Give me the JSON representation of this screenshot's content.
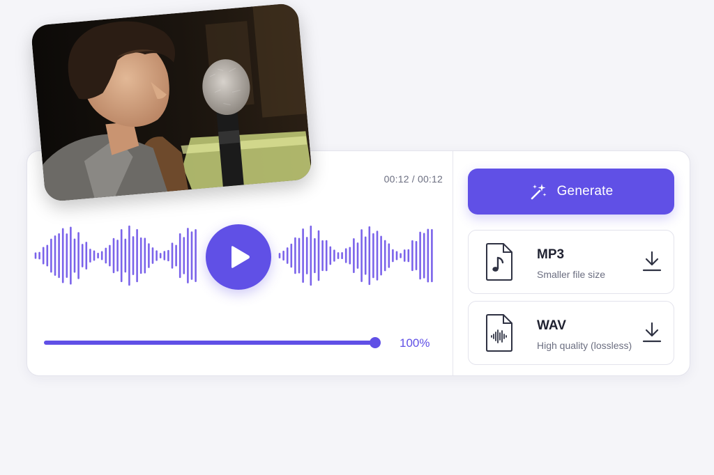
{
  "player": {
    "time_display": "00:12 / 00:12",
    "volume_label": "100%",
    "volume_level": 1.0,
    "play_icon": "play-icon"
  },
  "generate": {
    "label": "Generate",
    "icon": "magic-wand-sparkle-icon"
  },
  "formats": [
    {
      "name": "MP3",
      "description": "Smaller file size",
      "icon": "music-file-icon",
      "action_icon": "download-icon"
    },
    {
      "name": "WAV",
      "description": "High quality (lossless)",
      "icon": "audio-wave-file-icon",
      "action_icon": "download-icon"
    }
  ],
  "photo": {
    "subject": "person speaking into microphone"
  },
  "colors": {
    "accent": "#6050e6",
    "wave": "#7a63ea",
    "background": "#f5f5f9",
    "text": "#1f2130",
    "muted": "#6b6e80"
  }
}
